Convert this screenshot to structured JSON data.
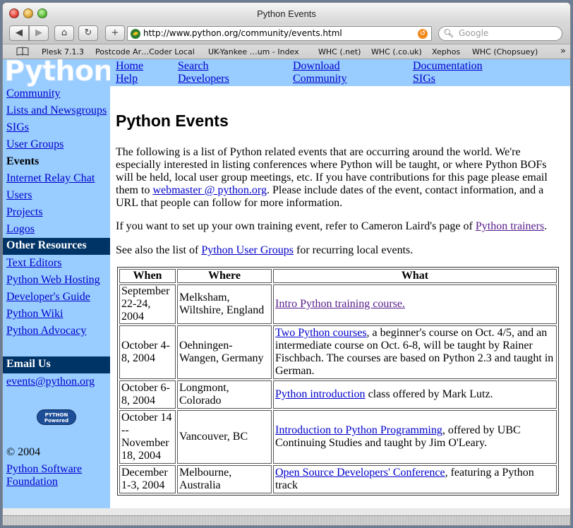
{
  "window": {
    "title": "Python Events"
  },
  "toolbar": {
    "back": "◀",
    "forward": "▶",
    "home": "⌂",
    "reload": "↻",
    "add": "+",
    "url": "http://www.python.org/community/events.html",
    "search_placeholder": "Google"
  },
  "bookmarks": [
    "Plesk 7.1.3",
    "Postcode Ar…Coder Local",
    "UK-Yankee …um - Index",
    "WHC (.net)",
    "WHC (.co.uk)",
    "Xephos",
    "WHC (Chopsuey)"
  ],
  "logo": {
    "text": "Python"
  },
  "topnav": {
    "home": "Home",
    "help": "Help",
    "search": "Search",
    "developers": "Developers",
    "download": "Download",
    "community": "Community",
    "documentation": "Documentation",
    "sigs": "SIGs"
  },
  "sidebar": {
    "community": "Community",
    "lists": "Lists and Newsgroups",
    "sigs": "SIGs",
    "user_groups": "User Groups",
    "events": "Events",
    "irc": "Internet Relay Chat",
    "users": "Users",
    "projects": "Projects",
    "logos": "Logos",
    "other_resources": "Other Resources",
    "text_editors": "Text Editors",
    "web_hosting": "Python Web Hosting",
    "dev_guide": "Developer's Guide",
    "wiki": "Python Wiki",
    "advocacy": "Python Advocacy",
    "email_us": "Email Us",
    "email": "events@python.org",
    "powered_1": "PYTHON",
    "powered_2": "Powered",
    "copyright": "© 2004",
    "psf_1": "Python Software",
    "psf_2": "Foundation"
  },
  "content": {
    "title": "Python Events",
    "intro_1": "The following is a list of Python related events that are occurring around the world. We're especially interested in listing conferences where Python will be taught, or where Python BOFs will be held, local user group meetings, etc. If you have contributions for this page please email them to ",
    "intro_link": "webmaster @ python.org",
    "intro_2": ". Please include dates of the event, contact information, and a URL that people can follow for more information.",
    "training_1": "If you want to set up your own training event, refer to Cameron Laird's page of ",
    "training_link": "Python trainers",
    "training_2": ".",
    "groups_1": "See also the list of ",
    "groups_link": "Python User Groups",
    "groups_2": " for recurring local events."
  },
  "table": {
    "headers": [
      "When",
      "Where",
      "What"
    ],
    "rows": [
      {
        "when": "September 22-24, 2004",
        "where": "Melksham, Wiltshire, England",
        "link": "Intro Python training course.",
        "rest": ""
      },
      {
        "when": "October 4-8, 2004",
        "where": "Oehningen-Wangen, Germany",
        "link": "Two Python courses",
        "rest": ", a beginner's course on Oct. 4/5, and an intermediate course on Oct. 6-8, will be taught by Rainer Fischbach. The courses are based on Python 2.3 and taught in German."
      },
      {
        "when": "October 6-8, 2004",
        "where": "Longmont, Colorado",
        "link": "Python introduction",
        "rest": " class offered by Mark Lutz."
      },
      {
        "when": "October 14 -- November 18, 2004",
        "where": "Vancouver, BC",
        "link": "Introduction to Python Programming",
        "rest": ", offered by UBC Continuing Studies and taught by Jim O'Leary."
      },
      {
        "when": "December 1-3, 2004",
        "where": "Melbourne, Australia",
        "link": "Open Source Developers' Conference",
        "rest": ", featuring a Python track"
      }
    ]
  }
}
